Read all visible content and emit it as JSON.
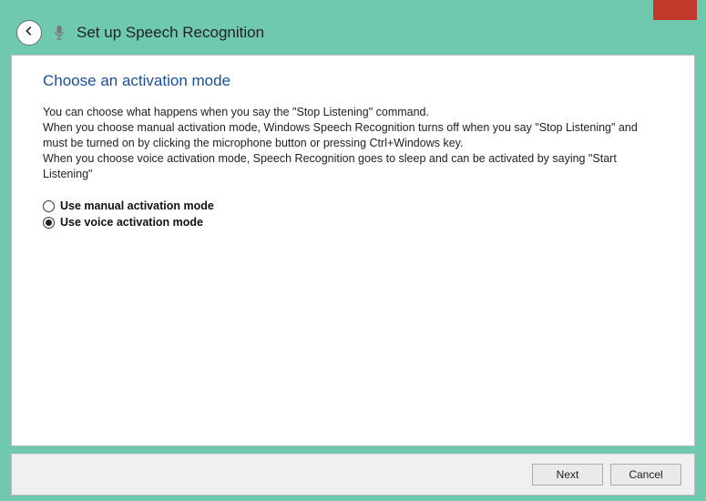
{
  "window": {
    "title": "Set up Speech Recognition"
  },
  "content": {
    "heading": "Choose an activation mode",
    "description": "You can choose what happens when you say the \"Stop Listening\" command.\nWhen you choose manual activation mode, Windows Speech Recognition turns off when you say \"Stop Listening\" and must be turned on by clicking the microphone button or pressing Ctrl+Windows key.\nWhen you choose voice activation mode, Speech Recognition goes to sleep and can be activated by saying \"Start Listening\""
  },
  "options": {
    "manual": {
      "label": "Use manual activation mode",
      "selected": false
    },
    "voice": {
      "label": "Use voice activation mode",
      "selected": true
    }
  },
  "buttons": {
    "next": "Next",
    "cancel": "Cancel"
  }
}
